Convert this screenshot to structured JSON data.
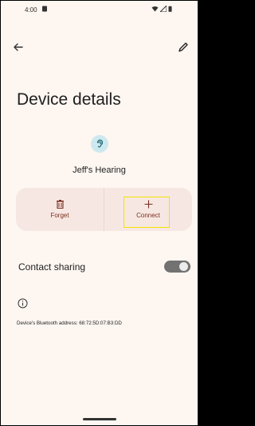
{
  "status_bar": {
    "time": "4:00"
  },
  "page": {
    "title": "Device details"
  },
  "device": {
    "name": "Jeff's Hearing"
  },
  "actions": {
    "forget_label": "Forget",
    "connect_label": "Connect"
  },
  "settings": {
    "contact_sharing_label": "Contact sharing",
    "contact_sharing_on": false
  },
  "info": {
    "bluetooth_address": "Device's Bluetooth address: 68:72:5D:07:B3:DD"
  },
  "icons": {
    "back": "arrow-back-icon",
    "edit": "pencil-icon",
    "device": "hearing-icon",
    "forget": "trash-icon",
    "connect": "plus-icon",
    "info": "info-icon"
  },
  "colors": {
    "accent": "#7a2f20",
    "background": "#fdf6f1",
    "device_icon_bg": "#cde9ef",
    "highlight": "#f2e300"
  }
}
